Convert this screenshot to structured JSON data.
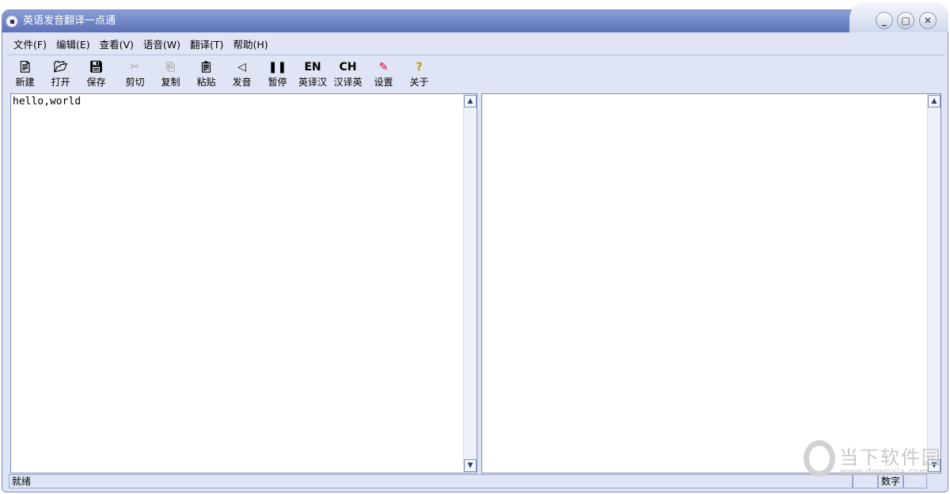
{
  "window": {
    "title": "英语发音翻译一点通",
    "buttons": {
      "minimize": "_",
      "maximize": "□",
      "close": "✕"
    }
  },
  "menu": [
    "文件(F)",
    "编辑(E)",
    "查看(V)",
    "语音(W)",
    "翻译(T)",
    "帮助(H)"
  ],
  "toolbar": [
    {
      "label": "新建",
      "icon": "📄︎",
      "name": "new",
      "enabled": true
    },
    {
      "label": "打开",
      "icon": "📂︎",
      "name": "open",
      "enabled": true
    },
    {
      "label": "保存",
      "icon": "💾︎",
      "name": "save",
      "enabled": true
    },
    {
      "label": "剪切",
      "icon": "✂",
      "name": "cut",
      "enabled": false
    },
    {
      "label": "复制",
      "icon": "⎘",
      "name": "copy",
      "enabled": false
    },
    {
      "label": "粘贴",
      "icon": "📋︎",
      "name": "paste",
      "enabled": true
    },
    {
      "label": "发音",
      "icon": "◁",
      "name": "speak",
      "enabled": true
    },
    {
      "label": "暂停",
      "icon": "❚❚",
      "name": "pause",
      "enabled": true
    },
    {
      "label": "英译汉",
      "icon": "EN",
      "name": "en-to-cn",
      "enabled": true
    },
    {
      "label": "汉译英",
      "icon": "CH",
      "name": "cn-to-en",
      "enabled": true
    },
    {
      "label": "设置",
      "icon": "✎",
      "name": "settings",
      "enabled": true
    },
    {
      "label": "关于",
      "icon": "?",
      "name": "about",
      "enabled": true
    }
  ],
  "left_pane": {
    "text": "hello,world"
  },
  "right_pane": {
    "text": ""
  },
  "status": {
    "ready": "就绪",
    "num": "数字"
  },
  "watermark": {
    "name": "当下软件园",
    "url": "www.downxia.com"
  },
  "colors": {
    "title_bar": "#5d72b8",
    "frame": "#dfe5f5"
  }
}
